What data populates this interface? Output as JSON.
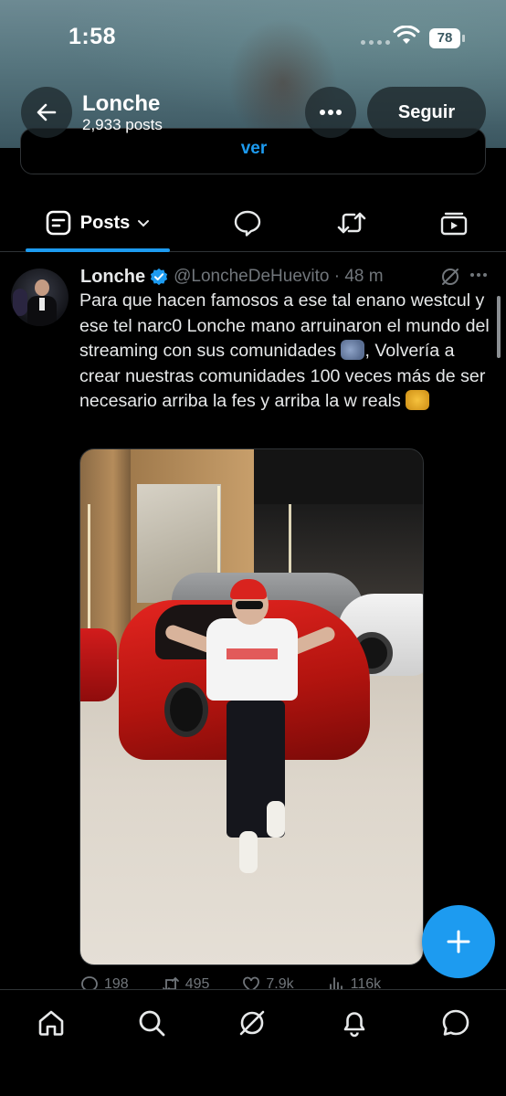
{
  "status_bar": {
    "time": "1:58",
    "battery": "78"
  },
  "header": {
    "name": "Lonche",
    "post_count": "2,933 posts",
    "follow_label": "Seguir",
    "prev_card_label": "ver"
  },
  "tabs": {
    "posts_label": "Posts",
    "items": [
      "posts",
      "replies",
      "reposts",
      "media"
    ]
  },
  "post": {
    "author_name": "Lonche",
    "verified": true,
    "handle_time": "@LoncheDeHuevito · 48 m",
    "text_part1": "Para que hacen famosos a ese tal enano westcul y ese tel narc0 Lonche mano arruinaron el mundo del streaming con sus comunidades ",
    "text_part2": ", Volvería a crear nuestras comunidades 100 veces más de ser necesario arriba la fes y arriba la w reals ",
    "stats": {
      "replies": "198",
      "reposts": "495",
      "likes": "7.9k",
      "views": "116k"
    }
  },
  "colors": {
    "accent": "#1d9bf0",
    "background": "#000000",
    "text": "#e7e9ea",
    "muted": "#71767b"
  }
}
